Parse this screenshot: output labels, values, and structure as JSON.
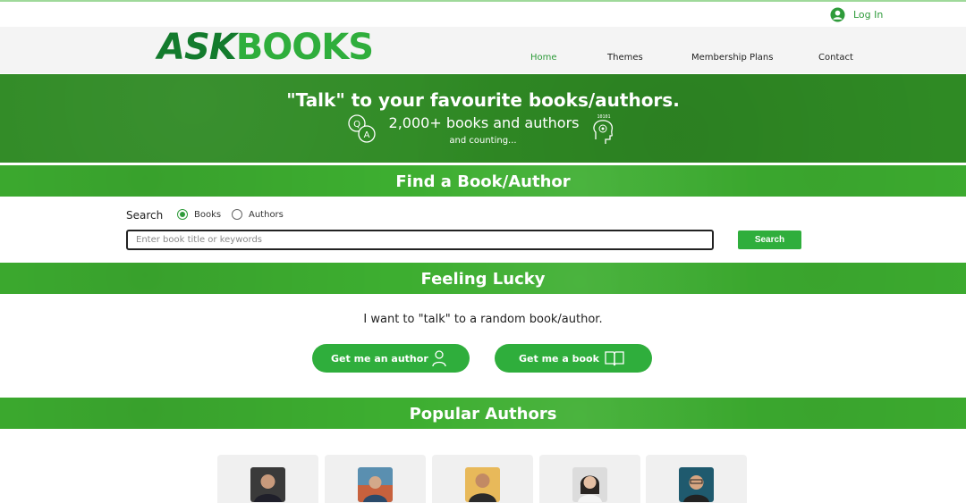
{
  "topbar": {
    "login_label": "Log In"
  },
  "brand": {
    "logo_part1": "ASK",
    "logo_part2": "BOOKS"
  },
  "nav": [
    {
      "label": "Home",
      "active": true
    },
    {
      "label": "Themes",
      "active": false
    },
    {
      "label": "Membership Plans",
      "active": false
    },
    {
      "label": "Contact",
      "active": false
    }
  ],
  "hero": {
    "title": "\"Talk\" to your favourite books/authors.",
    "subtitle": "2,000+ books and authors",
    "small": "and counting...",
    "left_icon": "qa-bubbles-icon",
    "right_icon": "brain-binary-icon",
    "right_icon_text": "10101"
  },
  "find": {
    "heading": "Find a Book/Author",
    "search_label": "Search",
    "radio_books": "Books",
    "radio_authors": "Authors",
    "selected": "Books",
    "input_value": "",
    "input_placeholder": "Enter book title or keywords",
    "search_button": "Search"
  },
  "lucky": {
    "heading": "Feeling Lucky",
    "text": "I want to \"talk\" to a random book/author.",
    "author_button": "Get me an author",
    "book_button": "Get me a book"
  },
  "popular": {
    "heading": "Popular Authors",
    "authors": [
      {
        "photo": "author-photo-1"
      },
      {
        "photo": "author-photo-2"
      },
      {
        "photo": "author-photo-3"
      },
      {
        "photo": "author-photo-4"
      },
      {
        "photo": "author-photo-5"
      }
    ]
  },
  "colors": {
    "brand_green": "#2fae3c",
    "dark_green": "#137b2d",
    "hero_green": "#2f8a24",
    "band_green": "#3dae30",
    "link_green": "#2e9b3a"
  }
}
